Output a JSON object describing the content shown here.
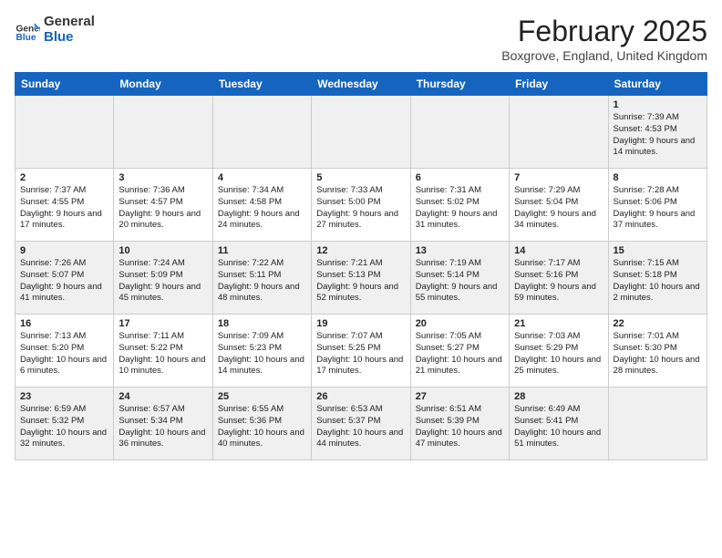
{
  "header": {
    "logo_line1": "General",
    "logo_line2": "Blue",
    "month_title": "February 2025",
    "location": "Boxgrove, England, United Kingdom"
  },
  "weekdays": [
    "Sunday",
    "Monday",
    "Tuesday",
    "Wednesday",
    "Thursday",
    "Friday",
    "Saturday"
  ],
  "weeks": [
    [
      {
        "day": "",
        "info": ""
      },
      {
        "day": "",
        "info": ""
      },
      {
        "day": "",
        "info": ""
      },
      {
        "day": "",
        "info": ""
      },
      {
        "day": "",
        "info": ""
      },
      {
        "day": "",
        "info": ""
      },
      {
        "day": "1",
        "info": "Sunrise: 7:39 AM\nSunset: 4:53 PM\nDaylight: 9 hours and 14 minutes."
      }
    ],
    [
      {
        "day": "2",
        "info": "Sunrise: 7:37 AM\nSunset: 4:55 PM\nDaylight: 9 hours and 17 minutes."
      },
      {
        "day": "3",
        "info": "Sunrise: 7:36 AM\nSunset: 4:57 PM\nDaylight: 9 hours and 20 minutes."
      },
      {
        "day": "4",
        "info": "Sunrise: 7:34 AM\nSunset: 4:58 PM\nDaylight: 9 hours and 24 minutes."
      },
      {
        "day": "5",
        "info": "Sunrise: 7:33 AM\nSunset: 5:00 PM\nDaylight: 9 hours and 27 minutes."
      },
      {
        "day": "6",
        "info": "Sunrise: 7:31 AM\nSunset: 5:02 PM\nDaylight: 9 hours and 31 minutes."
      },
      {
        "day": "7",
        "info": "Sunrise: 7:29 AM\nSunset: 5:04 PM\nDaylight: 9 hours and 34 minutes."
      },
      {
        "day": "8",
        "info": "Sunrise: 7:28 AM\nSunset: 5:06 PM\nDaylight: 9 hours and 37 minutes."
      }
    ],
    [
      {
        "day": "9",
        "info": "Sunrise: 7:26 AM\nSunset: 5:07 PM\nDaylight: 9 hours and 41 minutes."
      },
      {
        "day": "10",
        "info": "Sunrise: 7:24 AM\nSunset: 5:09 PM\nDaylight: 9 hours and 45 minutes."
      },
      {
        "day": "11",
        "info": "Sunrise: 7:22 AM\nSunset: 5:11 PM\nDaylight: 9 hours and 48 minutes."
      },
      {
        "day": "12",
        "info": "Sunrise: 7:21 AM\nSunset: 5:13 PM\nDaylight: 9 hours and 52 minutes."
      },
      {
        "day": "13",
        "info": "Sunrise: 7:19 AM\nSunset: 5:14 PM\nDaylight: 9 hours and 55 minutes."
      },
      {
        "day": "14",
        "info": "Sunrise: 7:17 AM\nSunset: 5:16 PM\nDaylight: 9 hours and 59 minutes."
      },
      {
        "day": "15",
        "info": "Sunrise: 7:15 AM\nSunset: 5:18 PM\nDaylight: 10 hours and 2 minutes."
      }
    ],
    [
      {
        "day": "16",
        "info": "Sunrise: 7:13 AM\nSunset: 5:20 PM\nDaylight: 10 hours and 6 minutes."
      },
      {
        "day": "17",
        "info": "Sunrise: 7:11 AM\nSunset: 5:22 PM\nDaylight: 10 hours and 10 minutes."
      },
      {
        "day": "18",
        "info": "Sunrise: 7:09 AM\nSunset: 5:23 PM\nDaylight: 10 hours and 14 minutes."
      },
      {
        "day": "19",
        "info": "Sunrise: 7:07 AM\nSunset: 5:25 PM\nDaylight: 10 hours and 17 minutes."
      },
      {
        "day": "20",
        "info": "Sunrise: 7:05 AM\nSunset: 5:27 PM\nDaylight: 10 hours and 21 minutes."
      },
      {
        "day": "21",
        "info": "Sunrise: 7:03 AM\nSunset: 5:29 PM\nDaylight: 10 hours and 25 minutes."
      },
      {
        "day": "22",
        "info": "Sunrise: 7:01 AM\nSunset: 5:30 PM\nDaylight: 10 hours and 28 minutes."
      }
    ],
    [
      {
        "day": "23",
        "info": "Sunrise: 6:59 AM\nSunset: 5:32 PM\nDaylight: 10 hours and 32 minutes."
      },
      {
        "day": "24",
        "info": "Sunrise: 6:57 AM\nSunset: 5:34 PM\nDaylight: 10 hours and 36 minutes."
      },
      {
        "day": "25",
        "info": "Sunrise: 6:55 AM\nSunset: 5:36 PM\nDaylight: 10 hours and 40 minutes."
      },
      {
        "day": "26",
        "info": "Sunrise: 6:53 AM\nSunset: 5:37 PM\nDaylight: 10 hours and 44 minutes."
      },
      {
        "day": "27",
        "info": "Sunrise: 6:51 AM\nSunset: 5:39 PM\nDaylight: 10 hours and 47 minutes."
      },
      {
        "day": "28",
        "info": "Sunrise: 6:49 AM\nSunset: 5:41 PM\nDaylight: 10 hours and 51 minutes."
      },
      {
        "day": "",
        "info": ""
      }
    ]
  ]
}
